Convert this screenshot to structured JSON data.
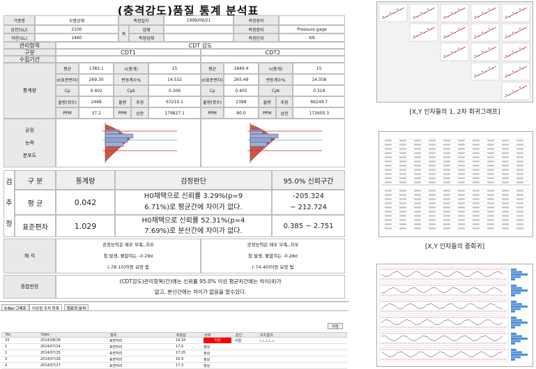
{
  "report": {
    "title": "(충격강도)품질 통계 분석표",
    "info": {
      "row1": [
        "기종명",
        "부품업체",
        "측정일자",
        "1999/09/21",
        "측정장비",
        ""
      ],
      "row2": [
        "상한(SU)",
        "2100",
        "측",
        "업체",
        "측정장비",
        "Pressure gage"
      ],
      "row3": [
        "하한(SL)",
        "1460",
        "정",
        "측정업체",
        "측정단위",
        "kN"
      ]
    },
    "item_label": "관리항목",
    "item_value": "CDT 강도",
    "group_label": "구분",
    "cdt1": "CDT1",
    "cdt2": "CDT2",
    "period_label": "수집기간",
    "stats_label": "통계량",
    "cdt1_stats": [
      [
        "평균",
        "1383.1",
        "n(총개)",
        "15"
      ],
      [
        "σ(표준편차)",
        "269.30",
        "변동계수%",
        "14.532"
      ],
      [
        "Cp",
        "0.402",
        "Cpk",
        "0.306"
      ],
      [
        "불량(갯수)",
        "2468",
        "불량",
        "추정",
        "67210.1"
      ],
      [
        "PPM",
        "37.2",
        "PPM",
        "상한",
        "179827.1"
      ]
    ],
    "cdt2_stats": [
      [
        "평균",
        "1849.4",
        "n(총개)",
        "15"
      ],
      [
        "σ(표준편차)",
        "265.49",
        "변동계수%",
        "14.358"
      ],
      [
        "Cp",
        "0.405",
        "Cpk",
        "0.318"
      ],
      [
        "불량(갯수)",
        "2388",
        "불량",
        "추정",
        "66249.7"
      ],
      [
        "PPM",
        "80.0",
        "PPM",
        "상한",
        "172600.3"
      ]
    ],
    "dist_label": [
      "공정",
      "능력",
      "분포도"
    ],
    "test": {
      "side": [
        "검",
        "추",
        "정"
      ],
      "headers": [
        "구 분",
        "통계량",
        "검정판단",
        "95.0% 신뢰구간"
      ],
      "row1": {
        "name": "평 균",
        "stat": "0.042",
        "judge1": "H0채택으로 신뢰률 3.29%(p=9",
        "judge2": "6.71%)로 평균간에 차이가 없다.",
        "ci1": "-205.324",
        "ci2": "~ 212.724"
      },
      "row2": {
        "name": "표준편차",
        "stat": "1.029",
        "judge1": "H0채택으로 신뢰률 52.31%(p=4",
        "judge2": "7.69%)로 분산간에 차이가 없다.",
        "ci": "0.385 ~ 2.751"
      }
    },
    "interp_label": "해 석",
    "interp_cdt1": [
      "공정능력은 매우 부족,,치우",
      "침 발생, 불합치는 -0.29σ",
      "(-78.10)이동 요망 됨"
    ],
    "interp_cdt2": [
      "공정능력은 매우 부족,,치우",
      "침 발생, 불합치는 -0.28σ",
      "(-74.40)이동 요망 됨"
    ],
    "conclusion_label": "종합판정",
    "conclusion": [
      "(CDT강도)관리항목(간)에는 신뢰률 95.0% 이상 평균치간에는 차이(4)가",
      "없고, 분산간에는 차이가 없음을 알수있다."
    ]
  },
  "captions": {
    "regression": "[X,Y 인자들의 1, 2차 회귀그래프]",
    "multi": "[X,Y 인자들의 중회귀]"
  },
  "grid": {
    "tabs": [
      "X-Bar 그래프",
      "이상점 조치 등록",
      "원료의 분석"
    ],
    "button": "저장",
    "columns": [
      "No.",
      "Date",
      "항목",
      "측정값",
      "상태",
      "원인",
      "조치결과"
    ],
    "rows": [
      {
        "no": "33",
        "date": "2014/08/28",
        "item": "표면처리",
        "value": "19.34",
        "status": "이상",
        "cause": "이탈",
        "action": "ㄴㄴㄴㄴㄴ"
      },
      {
        "no": "1",
        "date": "2014/07/24",
        "item": "표면처리",
        "value": "17.6",
        "status": "정상",
        "cause": "",
        "action": ""
      },
      {
        "no": "2",
        "date": "2014/07/25",
        "item": "표면처리",
        "value": "17.05",
        "status": "정상",
        "cause": "",
        "action": ""
      },
      {
        "no": "3",
        "date": "2014/07/26",
        "item": "표면처리",
        "value": "16.9",
        "status": "정상",
        "cause": "",
        "action": ""
      },
      {
        "no": "4",
        "date": "2014/07/27",
        "item": "표면처리",
        "value": "17.3",
        "status": "정상",
        "cause": "",
        "action": ""
      }
    ]
  },
  "colors": {
    "alarm": "#ff0000",
    "curve": "#cc2222",
    "bars": "#9ab0d8"
  }
}
